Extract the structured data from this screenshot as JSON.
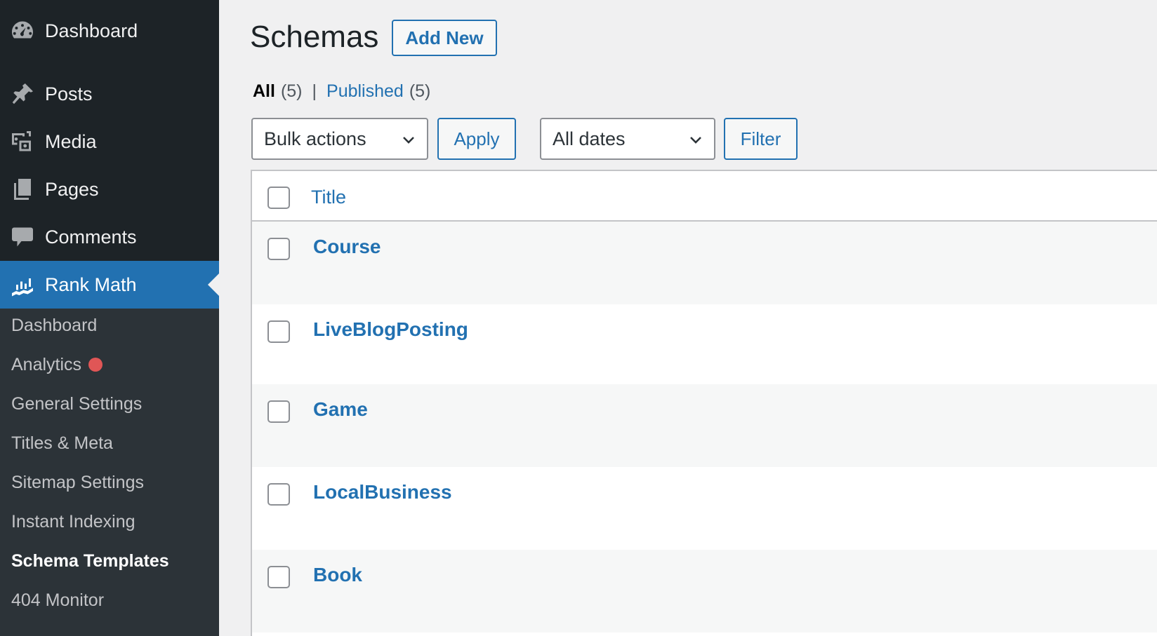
{
  "sidebar": {
    "menu": [
      {
        "label": "Dashboard",
        "icon": "dashboard-icon"
      },
      {
        "label": "Posts",
        "icon": "pin-icon"
      },
      {
        "label": "Media",
        "icon": "media-icon"
      },
      {
        "label": "Pages",
        "icon": "pages-icon"
      },
      {
        "label": "Comments",
        "icon": "comment-icon"
      },
      {
        "label": "Rank Math",
        "icon": "rank-math-icon",
        "active": true
      }
    ],
    "submenu": [
      {
        "label": "Dashboard"
      },
      {
        "label": "Analytics",
        "badge": true
      },
      {
        "label": "General Settings"
      },
      {
        "label": "Titles & Meta"
      },
      {
        "label": "Sitemap Settings"
      },
      {
        "label": "Instant Indexing"
      },
      {
        "label": "Schema Templates",
        "current": true
      },
      {
        "label": "404 Monitor"
      }
    ]
  },
  "header": {
    "title": "Schemas",
    "add_new_label": "Add New"
  },
  "views": {
    "all_label": "All",
    "all_count": "(5)",
    "separator": "|",
    "published_label": "Published",
    "published_count": "(5)"
  },
  "toolbar": {
    "bulk_actions": "Bulk actions",
    "apply_label": "Apply",
    "dates": "All dates",
    "filter_label": "Filter"
  },
  "table": {
    "column_title": "Title",
    "rows": [
      {
        "title": "Course"
      },
      {
        "title": "LiveBlogPosting"
      },
      {
        "title": "Game"
      },
      {
        "title": "LocalBusiness"
      },
      {
        "title": "Book"
      }
    ]
  },
  "colors": {
    "sidebar_bg": "#1d2327",
    "submenu_bg": "#2c3338",
    "accent": "#2271b1",
    "badge": "#e05656"
  }
}
